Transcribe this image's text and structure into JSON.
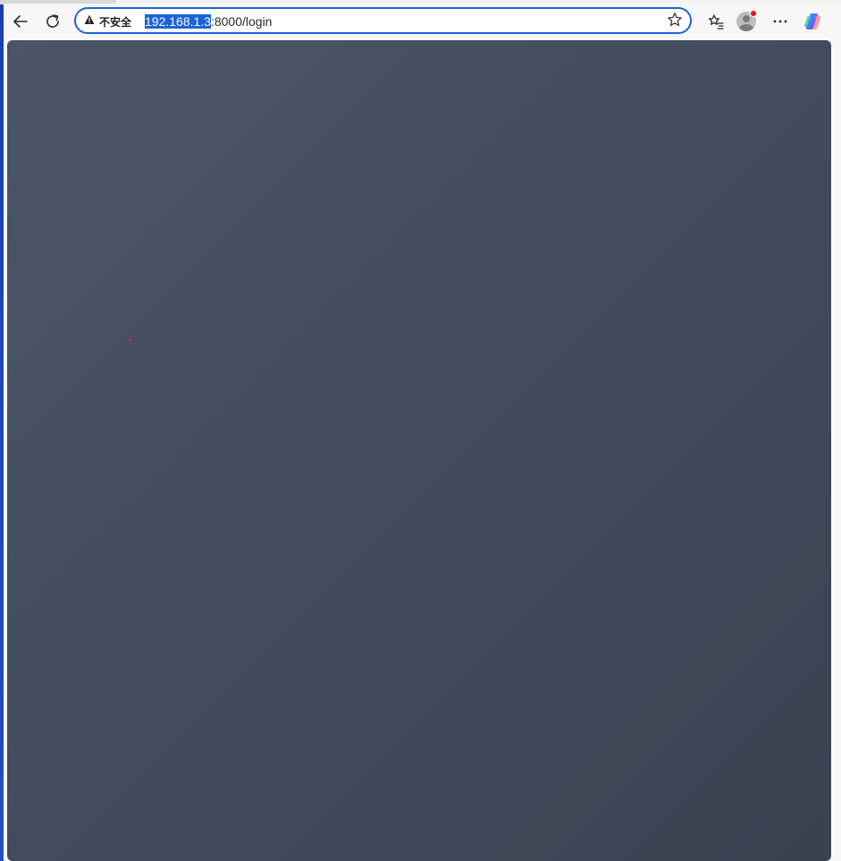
{
  "browser": {
    "back_button_label": "Back",
    "refresh_button_label": "Refresh",
    "security_label": "不安全",
    "url_selected": "192.168.1.3",
    "url_rest": ":8000/login",
    "icons": [
      "back-arrow-icon",
      "refresh-icon",
      "warning-icon",
      "star-icon",
      "favorites-icon",
      "profile-icon",
      "more-icon",
      "copilot-icon"
    ],
    "accent_color": "#1f63d8",
    "notification_color": "#e81123"
  },
  "page": {
    "background_gradient": [
      "#4a5566",
      "#3a4250"
    ]
  }
}
